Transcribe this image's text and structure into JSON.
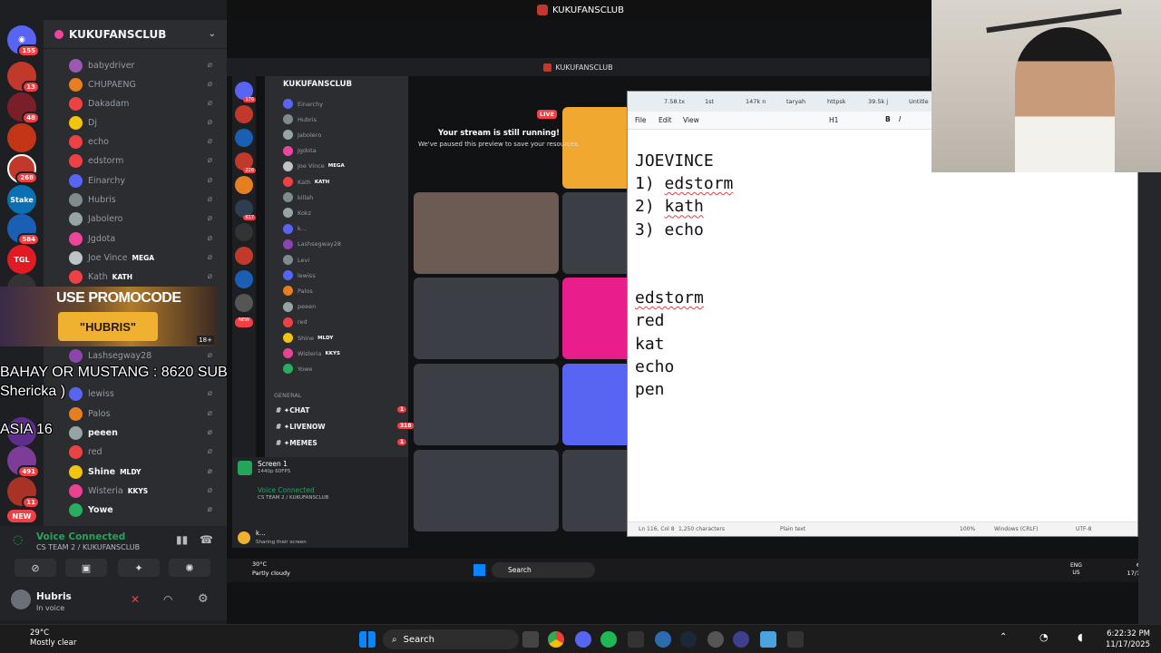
{
  "top_title": "KUKUFANSCLUB",
  "rail_servers": [
    {
      "badge": "155",
      "color": "#5865f2"
    },
    {
      "badge": "13",
      "color": "#c0392b"
    },
    {
      "badge": "48",
      "color": "#7a1f2a"
    },
    {
      "badge": "",
      "color": "#c23616"
    },
    {
      "badge": "268",
      "color": "#c0392b"
    },
    {
      "badge": "",
      "color": "#0b6fb3",
      "label": "Stake"
    },
    {
      "badge": "584",
      "color": "#1a5fb4"
    },
    {
      "badge": "",
      "color": "#e01b24",
      "label": "TGL"
    },
    {
      "badge": "289",
      "color": "#333"
    },
    {
      "badge": "",
      "color": "#5d2e8c"
    },
    {
      "badge": "491",
      "color": "#7d3c98"
    },
    {
      "badge": "11",
      "color": "#a93226"
    },
    {
      "badge": "NEW",
      "color": "#f23f43"
    }
  ],
  "server_name": "KUKUFANSCLUB",
  "members": [
    {
      "name": "babydriver",
      "color": "#9b59b6"
    },
    {
      "name": "CHUPAENG",
      "color": "#e67e22"
    },
    {
      "name": "Dakadam",
      "color": "#ed4245"
    },
    {
      "name": "Dj",
      "color": "#f1c40f"
    },
    {
      "name": "echo",
      "color": "#ed4245"
    },
    {
      "name": "edstorm",
      "color": "#ed4245"
    },
    {
      "name": "Einarchy",
      "color": "#5865f2"
    },
    {
      "name": "Hubris",
      "color": "#7f8c8d"
    },
    {
      "name": "Jabolero",
      "color": "#95a5a6"
    },
    {
      "name": "Jgdota",
      "color": "#eb459e"
    },
    {
      "name": "Joe Vince",
      "color": "#bdc3c7",
      "tag": "MEGA"
    },
    {
      "name": "Kath",
      "color": "#ed4245",
      "tag": "KATH"
    }
  ],
  "members_lower": [
    {
      "name": "Lashsegway28",
      "color": "#8e44ad"
    },
    {
      "name": "lewiss",
      "color": "#5865f2"
    },
    {
      "name": "Palos",
      "color": "#e67e22"
    },
    {
      "name": "peeen",
      "color": "#95a5a6",
      "bright": true
    },
    {
      "name": "red",
      "color": "#ed4245"
    },
    {
      "name": "Shine",
      "color": "#f1c40f",
      "tag": "MLDY",
      "bright": true
    },
    {
      "name": "Wisteria",
      "color": "#e84393",
      "tag": "KKYS"
    },
    {
      "name": "Yowe",
      "color": "#27ae60",
      "bright": true
    }
  ],
  "promo": {
    "line1": "USE PROMOCODE",
    "line2": "\"HUBRIS\"",
    "age": "18+"
  },
  "overlay_lines": [
    "BAHAY OR MUSTANG : 8620 SUBS",
    "Shericka )",
    "ASIA 16"
  ],
  "voice": {
    "status": "Voice Connected",
    "channel": "CS TEAM 2 / KUKUFANSCLUB"
  },
  "user": {
    "name": "Hubris",
    "status": "In voice"
  },
  "weather": {
    "temp": "29°C",
    "desc": "Mostly clear"
  },
  "taskbar": {
    "search": "Search"
  },
  "clock": {
    "time": "6:22:32 PM",
    "date": "11/17/2025"
  },
  "tray": {
    "lang1": "ENG",
    "lang2": "US"
  },
  "inner": {
    "title": "KUKUFANSCLUB",
    "server_name": "KUKUFANSCLUB",
    "rail_badges": [
      "176",
      "",
      "",
      "226",
      "",
      "617",
      "",
      "",
      "",
      "",
      "NEW"
    ],
    "members": [
      {
        "name": "Einarchy",
        "color": "#5865f2"
      },
      {
        "name": "Hubris",
        "color": "#7f8c8d"
      },
      {
        "name": "Jabolero",
        "color": "#95a5a6"
      },
      {
        "name": "Jgdota",
        "color": "#eb459e"
      },
      {
        "name": "Joe Vince",
        "color": "#bdc3c7",
        "tag": "MEGA"
      },
      {
        "name": "Kath",
        "color": "#ed4245",
        "tag": "KATH"
      },
      {
        "name": "killah",
        "color": "#7f8c8d"
      },
      {
        "name": "Kokz",
        "color": "#95a5a6"
      },
      {
        "name": "k...",
        "color": "#5865f2"
      },
      {
        "name": "Lashsegway28",
        "color": "#8e44ad"
      },
      {
        "name": "Levi",
        "color": "#7f8c8d"
      },
      {
        "name": "lewiss",
        "color": "#5865f2"
      },
      {
        "name": "Palos",
        "color": "#e67e22"
      },
      {
        "name": "peeen",
        "color": "#95a5a6"
      },
      {
        "name": "red",
        "color": "#ed4245"
      },
      {
        "name": "Shine",
        "color": "#f1c40f",
        "tag": "MLDY"
      },
      {
        "name": "Wisteria",
        "color": "#e84393",
        "tag": "KKYS"
      },
      {
        "name": "Yowe",
        "color": "#27ae60"
      }
    ],
    "category": "GENERAL",
    "channels": [
      {
        "name": "✦CHAT",
        "badge": "1"
      },
      {
        "name": "✦LIVENOW",
        "badge": "318"
      },
      {
        "name": "✦MEMES",
        "badge": "1"
      }
    ],
    "screen_share": {
      "title": "Screen 1",
      "sub": "1440p 60FPS"
    },
    "voice": {
      "status": "Voice Connected",
      "channel": "CS TEAM 2 / KUKUFANSCLUB"
    },
    "user": {
      "name": "k...",
      "status": "Sharing their screen"
    },
    "stream_msg": {
      "title": "Your stream is still running!",
      "body": "We've paused this preview to save your resources."
    },
    "live": "LIVE",
    "weather": {
      "temp": "30°C",
      "desc": "Partly cloudy"
    },
    "search": "Search",
    "tray": {
      "lang1": "ENG",
      "lang2": "US"
    },
    "clock": {
      "time": "6:22 pm",
      "date": "17/11/2025"
    }
  },
  "notepad": {
    "tabs": [
      "7.58.tx",
      "1st",
      "147k n",
      "taryah",
      "httpsk",
      "39.5k j",
      "Untitle"
    ],
    "menu": [
      "File",
      "Edit",
      "View"
    ],
    "heading": "H1",
    "lines": [
      "JOEVINCE",
      "1) edstorm",
      "2) kath",
      "3) echo",
      "",
      "",
      "edstorm",
      "red",
      "kat",
      "echo",
      "pen"
    ],
    "status": {
      "pos": "Ln 116, Col 8",
      "chars": "1,250 characters",
      "mode": "Plain text",
      "zoom": "100%",
      "eol": "Windows (CRLF)",
      "enc": "UTF-8"
    }
  }
}
